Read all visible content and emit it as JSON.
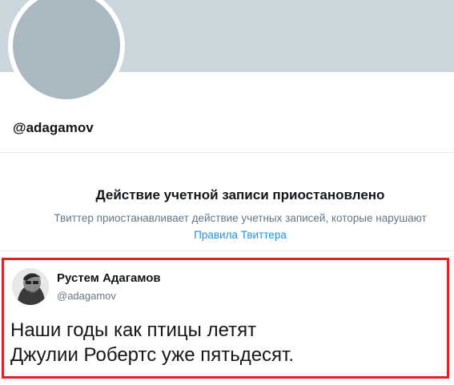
{
  "profile": {
    "handle": "@adagamov",
    "banner_color": "#ccd6dd",
    "avatar_color": "#aab8c2"
  },
  "suspension": {
    "title": "Действие учетной записи приостановлено",
    "description": "Твиттер приостанавливает действие учетных записей, которые нарушают",
    "rules_link": "Правила Твиттера"
  },
  "tweet": {
    "author_name": "Рустем Адагамов",
    "author_handle": "@adagamov",
    "avatar_icon": "user-photo-icon",
    "lines": [
      "Наши годы как птицы летят",
      "Джулии Робертс уже пятьдесят."
    ],
    "highlight_color": "#e02027"
  }
}
